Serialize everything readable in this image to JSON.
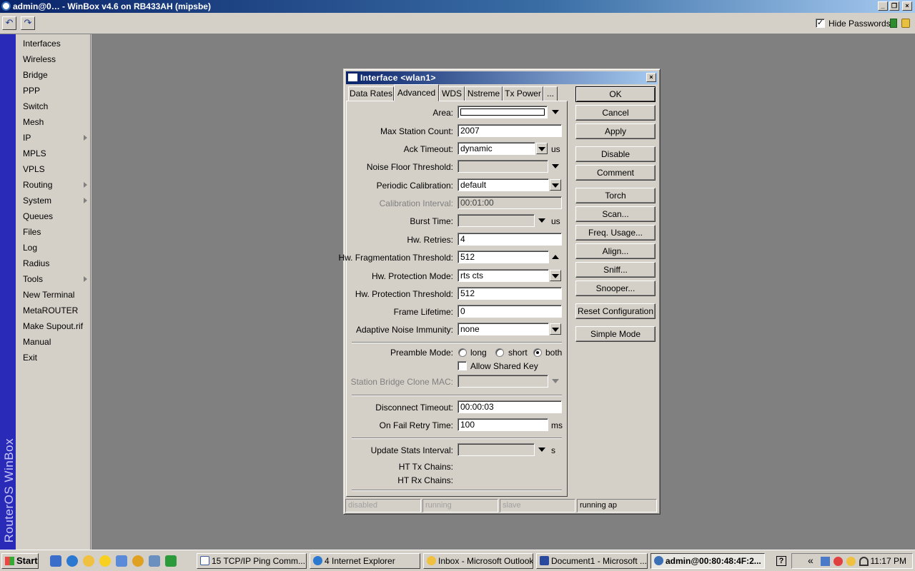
{
  "window": {
    "title": "admin@0… - WinBox v4.6 on RB433AH (mipsbe)"
  },
  "toolbar": {
    "hide_passwords_label": "Hide Passwords",
    "hide_passwords_checked": true
  },
  "sidebar": {
    "brand": "RouterOS WinBox",
    "items": [
      {
        "label": "Interfaces"
      },
      {
        "label": "Wireless"
      },
      {
        "label": "Bridge"
      },
      {
        "label": "PPP"
      },
      {
        "label": "Switch"
      },
      {
        "label": "Mesh"
      },
      {
        "label": "IP"
      },
      {
        "label": "MPLS"
      },
      {
        "label": "VPLS"
      },
      {
        "label": "Routing"
      },
      {
        "label": "System"
      },
      {
        "label": "Queues"
      },
      {
        "label": "Files"
      },
      {
        "label": "Log"
      },
      {
        "label": "Radius"
      },
      {
        "label": "Tools"
      },
      {
        "label": "New Terminal"
      },
      {
        "label": "MetaROUTER"
      },
      {
        "label": "Make Supout.rif"
      },
      {
        "label": "Manual"
      },
      {
        "label": "Exit"
      }
    ]
  },
  "dialog": {
    "title": "Interface <wlan1>",
    "tabs": [
      "Data Rates",
      "Advanced",
      "WDS",
      "Nstreme",
      "Tx Power",
      "..."
    ],
    "fields": {
      "area": {
        "label": "Area:",
        "value": ""
      },
      "max_station_count": {
        "label": "Max Station Count:",
        "value": "2007"
      },
      "ack_timeout": {
        "label": "Ack Timeout:",
        "value": "dynamic",
        "unit": "us"
      },
      "noise_floor_threshold": {
        "label": "Noise Floor Threshold:",
        "value": ""
      },
      "periodic_calibration": {
        "label": "Periodic Calibration:",
        "value": "default"
      },
      "calibration_interval": {
        "label": "Calibration Interval:",
        "value": "00:01:00"
      },
      "burst_time": {
        "label": "Burst Time:",
        "value": "",
        "unit": "us"
      },
      "hw_retries": {
        "label": "Hw. Retries:",
        "value": "4"
      },
      "hw_fragmentation_threshold": {
        "label": "Hw. Fragmentation Threshold:",
        "value": "512"
      },
      "hw_protection_mode": {
        "label": "Hw. Protection Mode:",
        "value": "rts cts"
      },
      "hw_protection_threshold": {
        "label": "Hw. Protection Threshold:",
        "value": "512"
      },
      "frame_lifetime": {
        "label": "Frame Lifetime:",
        "value": "0"
      },
      "adaptive_noise_immunity": {
        "label": "Adaptive Noise Immunity:",
        "value": "none"
      },
      "preamble_mode": {
        "label": "Preamble Mode:",
        "options": [
          "long",
          "short",
          "both"
        ],
        "selected": "both"
      },
      "allow_shared_key": {
        "label": "Allow Shared Key",
        "checked": false
      },
      "station_bridge_clone_mac": {
        "label": "Station Bridge Clone MAC:",
        "value": ""
      },
      "disconnect_timeout": {
        "label": "Disconnect Timeout:",
        "value": "00:00:03"
      },
      "on_fail_retry_time": {
        "label": "On Fail Retry Time:",
        "value": "100",
        "unit": "ms"
      },
      "update_stats_interval": {
        "label": "Update Stats Interval:",
        "value": "",
        "unit": "s"
      },
      "ht_tx_chains": {
        "label": "HT Tx Chains:"
      },
      "ht_rx_chains": {
        "label": "HT Rx Chains:"
      }
    },
    "buttons": {
      "ok": "OK",
      "cancel": "Cancel",
      "apply": "Apply",
      "disable": "Disable",
      "comment": "Comment",
      "torch": "Torch",
      "scan": "Scan...",
      "freq_usage": "Freq. Usage...",
      "align": "Align...",
      "sniff": "Sniff...",
      "snooper": "Snooper...",
      "reset_configuration": "Reset Configuration",
      "simple_mode": "Simple Mode"
    },
    "status": [
      "disabled",
      "running",
      "slave",
      "running ap"
    ]
  },
  "taskbar": {
    "start": "Start",
    "tasks": [
      {
        "label": "15 TCP/IP Ping Comm..."
      },
      {
        "label": "4 Internet Explorer"
      },
      {
        "label": "Inbox - Microsoft Outlook"
      },
      {
        "label": "Document1 - Microsoft ..."
      },
      {
        "label": "admin@00:80:48:4F:2..."
      }
    ],
    "clock": "11:17 PM"
  }
}
